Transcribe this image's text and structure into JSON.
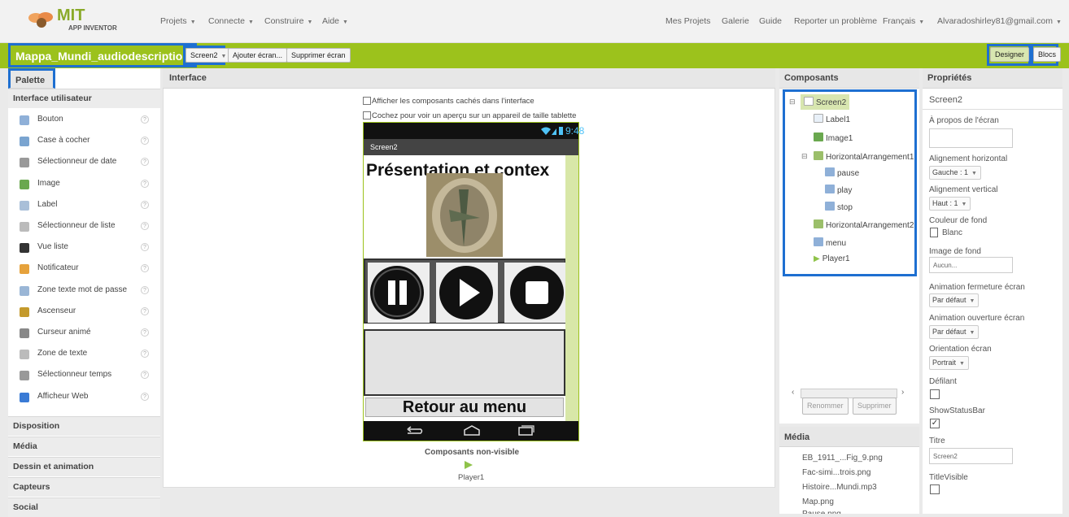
{
  "app": {
    "logo_title": "MIT",
    "logo_subtitle": "APP INVENTOR"
  },
  "topnav": {
    "left_menus": [
      "Projets",
      "Connecte",
      "Construire",
      "Aide"
    ],
    "right_links": [
      "Mes Projets",
      "Galerie",
      "Guide",
      "Reporter un problème"
    ],
    "language": "Français",
    "account": "Alvaradoshirley81@gmail.com"
  },
  "toolbar": {
    "project_name": "Mappa_Mundi_audiodescription",
    "screen_select": "Screen2",
    "add_screen": "Ajouter écran...",
    "remove_screen": "Supprimer écran",
    "designer": "Designer",
    "blocks": "Blocs"
  },
  "palette": {
    "title": "Palette",
    "ui_category": "Interface utilisateur",
    "items": [
      {
        "label": "Bouton",
        "icon": "button-icon",
        "color": "#8fb0d8"
      },
      {
        "label": "Case à cocher",
        "icon": "checkbox-icon",
        "color": "#7aa4d0"
      },
      {
        "label": "Sélectionneur de date",
        "icon": "datepicker-icon",
        "color": "#999999"
      },
      {
        "label": "Image",
        "icon": "image-icon",
        "color": "#6aa84f"
      },
      {
        "label": "Label",
        "icon": "label-icon",
        "color": "#a9bfd8"
      },
      {
        "label": "Sélectionneur de liste",
        "icon": "listpicker-icon",
        "color": "#bbbbbb"
      },
      {
        "label": "Vue liste",
        "icon": "listview-icon",
        "color": "#333333"
      },
      {
        "label": "Notificateur",
        "icon": "notifier-icon",
        "color": "#e6a23c"
      },
      {
        "label": "Zone texte mot de passe",
        "icon": "password-icon",
        "color": "#9ab6d6"
      },
      {
        "label": "Ascenseur",
        "icon": "slider-icon",
        "color": "#c49a2c"
      },
      {
        "label": "Curseur animé",
        "icon": "spinner-icon",
        "color": "#888888"
      },
      {
        "label": "Zone de texte",
        "icon": "textbox-icon",
        "color": "#bbbbbb"
      },
      {
        "label": "Sélectionneur temps",
        "icon": "timepicker-icon",
        "color": "#999999"
      },
      {
        "label": "Afficheur Web",
        "icon": "webviewer-icon",
        "color": "#3a7bd5"
      }
    ],
    "categories": [
      "Disposition",
      "Média",
      "Dessin et animation",
      "Capteurs",
      "Social"
    ]
  },
  "viewer": {
    "title": "Interface",
    "show_hidden_label": "Afficher les composants cachés dans l'interface",
    "tablet_preview_label": "Cochez pour voir un aperçu sur un appareil de taille tablette",
    "status_time": "9:48",
    "screen_title": "Screen2",
    "heading_text": "Présentation et contex",
    "back_button": "Retour au menu",
    "nonvisible_title": "Composants non-visible",
    "nonvisible_item": "Player1"
  },
  "components": {
    "title": "Composants",
    "tree": [
      "Screen2",
      "Label1",
      "Image1",
      "HorizontalArrangement1",
      "pause",
      "play",
      "stop",
      "HorizontalArrangement2",
      "menu",
      "Player1"
    ],
    "rename": "Renommer",
    "delete": "Supprimer"
  },
  "media": {
    "title": "Média",
    "files": [
      "EB_1911_...Fig_9.png",
      "Fac-simi...trois.png",
      "Histoire...Mundi.mp3",
      "Map.png",
      "Pause.png"
    ]
  },
  "properties": {
    "title": "Propriétés",
    "component": "Screen2",
    "about_label": "À propos de l'écran",
    "align_h_label": "Alignement horizontal",
    "align_h_value": "Gauche : 1",
    "align_v_label": "Alignement vertical",
    "align_v_value": "Haut : 1",
    "bg_color_label": "Couleur de fond",
    "bg_color_value": "Blanc",
    "bg_image_label": "Image de fond",
    "bg_image_value": "Aucun...",
    "close_anim_label": "Animation fermeture écran",
    "close_anim_value": "Par défaut",
    "open_anim_label": "Animation ouverture écran",
    "open_anim_value": "Par défaut",
    "orientation_label": "Orientation écran",
    "orientation_value": "Portrait",
    "scrollable_label": "Défilant",
    "statusbar_label": "ShowStatusBar",
    "title_label": "Titre",
    "title_value": "Screen2",
    "titlevisible_label": "TitleVisible"
  },
  "colors": {
    "accent_green": "#9cc21c",
    "highlight_blue": "#1e6fd1"
  }
}
